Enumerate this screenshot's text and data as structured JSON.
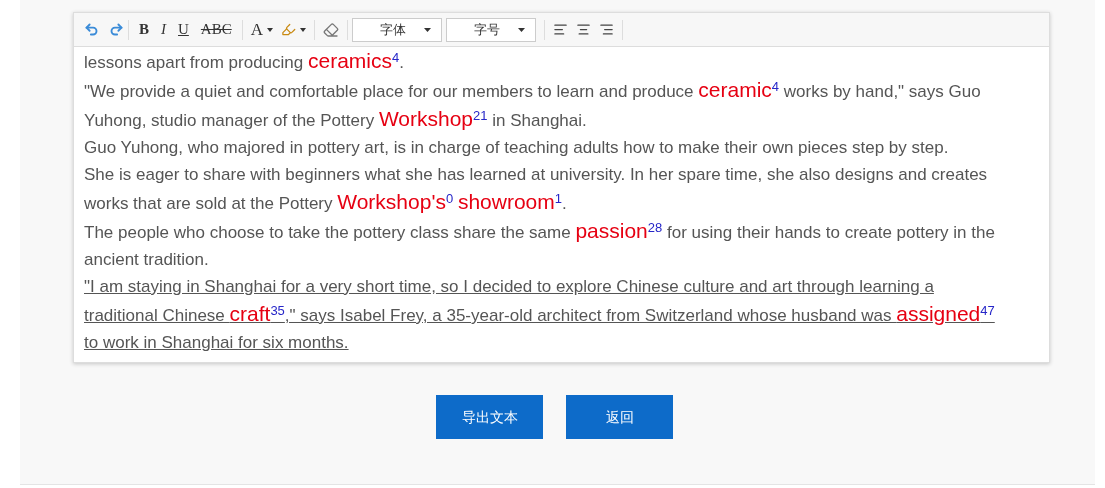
{
  "toolbar": {
    "format_buttons": [
      "B",
      "I",
      "U",
      "ABC"
    ],
    "font_color": "A",
    "font_select": {
      "value": "字体"
    },
    "size_select": {
      "value": "字号"
    }
  },
  "paragraphs": [
    {
      "underlined": false,
      "segments": [
        {
          "kind": "text",
          "text": "lessons apart from producing "
        },
        {
          "kind": "word",
          "text": "ceramics",
          "count": "4"
        },
        {
          "kind": "text",
          "text": "."
        }
      ]
    },
    {
      "underlined": false,
      "segments": [
        {
          "kind": "text",
          "text": "\"We provide a quiet and comfortable place for our members to learn and produce "
        },
        {
          "kind": "word",
          "text": "ceramic",
          "count": "4"
        },
        {
          "kind": "text",
          "text": " works by hand,\" says Guo Yuhong, studio manager of the Pottery "
        },
        {
          "kind": "word",
          "text": "Workshop",
          "count": "21"
        },
        {
          "kind": "text",
          "text": " in Shanghai."
        }
      ]
    },
    {
      "underlined": false,
      "segments": [
        {
          "kind": "text",
          "text": "Guo Yuhong, who majored in pottery art, is in charge of teaching adults how to make their own pieces step by step."
        }
      ]
    },
    {
      "underlined": false,
      "segments": [
        {
          "kind": "text",
          "text": "She is eager to share with beginners what she has learned at university. In her spare time, she also designs and creates works that are sold at the Pottery "
        },
        {
          "kind": "word",
          "text": "Workshop's",
          "count": "0"
        },
        {
          "kind": "space"
        },
        {
          "kind": "word",
          "text": "showroom",
          "count": "1"
        },
        {
          "kind": "text",
          "text": "."
        }
      ]
    },
    {
      "underlined": false,
      "segments": [
        {
          "kind": "text",
          "text": "The people who choose to take the pottery class share the same "
        },
        {
          "kind": "word",
          "text": "passion",
          "count": "28"
        },
        {
          "kind": "text",
          "text": " for using their hands to create pottery in the ancient tradition."
        }
      ]
    },
    {
      "underlined": true,
      "segments": [
        {
          "kind": "text",
          "text": "\"I am staying in Shanghai for a very short time, so I decided to explore Chinese culture and art through learning a traditional Chinese "
        },
        {
          "kind": "word",
          "text": "craft",
          "count": "35"
        },
        {
          "kind": "text",
          "text": ",\" says Isabel Frey, a 35-year-old architect from Switzerland whose husband was "
        },
        {
          "kind": "word",
          "text": "assigned",
          "count": "47"
        },
        {
          "kind": "text",
          "text": " to work in Shanghai for six months."
        }
      ]
    }
  ],
  "buttons": [
    "导出文本",
    "返回"
  ]
}
